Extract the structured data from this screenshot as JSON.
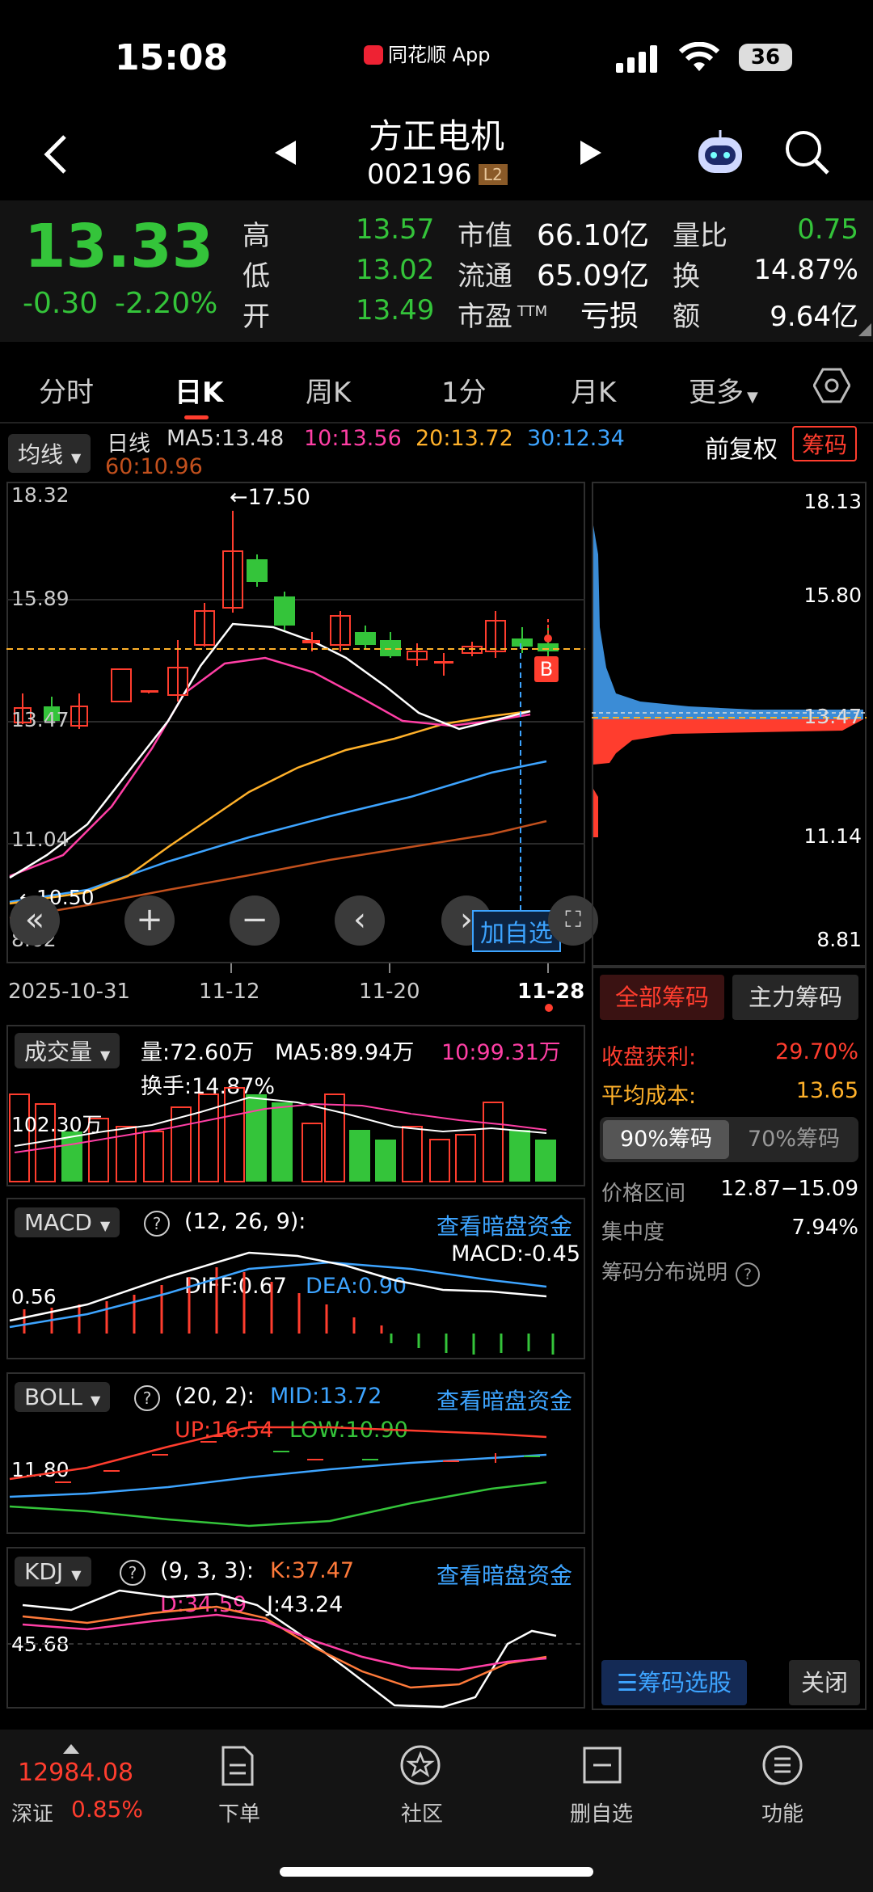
{
  "status": {
    "time": "15:08",
    "source_app": "同花顺 App",
    "battery": "36"
  },
  "header": {
    "name": "方正电机",
    "code": "002196",
    "level": "L2"
  },
  "quote": {
    "price": "13.33",
    "change": "-0.30",
    "change_pct": "-2.20%",
    "rows": [
      {
        "l1": "高",
        "v1": "13.57",
        "l2": "市值",
        "v2": "66.10亿",
        "l3": "量比",
        "v3": "0.75"
      },
      {
        "l1": "低",
        "v1": "13.02",
        "l2": "流通",
        "v2": "65.09亿",
        "l3": "换",
        "v3": "14.87%"
      },
      {
        "l1": "开",
        "v1": "13.49",
        "l2": "市盈",
        "v2": "亏损",
        "l3": "额",
        "v3": "9.64亿"
      }
    ],
    "ttm": "TTM"
  },
  "tabs": [
    "分时",
    "日K",
    "周K",
    "1分",
    "月K",
    "更多"
  ],
  "kline": {
    "indicator": "均线",
    "period": "日线",
    "ma5": "MA5:13.48",
    "ma10": "10:13.56",
    "ma20": "20:13.72",
    "ma30": "30:12.34",
    "ma60": "60:10.96",
    "adjust": "前复权",
    "chip_btn": "筹码",
    "y_labels": [
      "18.32",
      "15.89",
      "13.47",
      "11.04",
      "8.62"
    ],
    "high_mark": "←17.50",
    "low_mark": "←10.50",
    "buy_mark": "B",
    "dates": [
      "2025-10-31",
      "11-12",
      "11-20",
      "11-28"
    ],
    "add_watch": "加自选",
    "chip_y": [
      "18.13",
      "15.80",
      "13.47",
      "11.14",
      "8.81"
    ]
  },
  "chip": {
    "tab_all": "全部筹码",
    "tab_main": "主力筹码",
    "profit_label": "收盘获利:",
    "profit": "29.70%",
    "cost_label": "平均成本:",
    "cost": "13.65",
    "pct90": "90%筹码",
    "pct70": "70%筹码",
    "range_label": "价格区间",
    "range": "12.87−15.09",
    "conc_label": "集中度",
    "conc": "7.94%",
    "explain": "筹码分布说明",
    "select": "筹码选股",
    "close": "关闭"
  },
  "volume": {
    "name": "成交量",
    "vol": "量:72.60万",
    "ma5": "MA5:89.94万",
    "ma10": "10:99.31万",
    "turnover": "换手:14.87%",
    "y": "102.30万"
  },
  "macd": {
    "name": "MACD",
    "params": "(12, 26, 9):",
    "macd": "MACD:-0.45",
    "diff": "DIFF:0.67",
    "dea": "DEA:0.90",
    "y": "0.56",
    "link": "查看暗盘资金"
  },
  "boll": {
    "name": "BOLL",
    "params": "(20, 2):",
    "mid": "MID:13.72",
    "up": "UP:16.54",
    "low": "LOW:10.90",
    "y": "11.80",
    "link": "查看暗盘资金"
  },
  "kdj": {
    "name": "KDJ",
    "params": "(9, 3, 3):",
    "k": "K:37.47",
    "d": "D:34.59",
    "j": "J:43.24",
    "y": "45.68",
    "link": "查看暗盘资金"
  },
  "bottom": {
    "index_val": "12984.08",
    "index_name": "深证",
    "index_pct": "0.85%",
    "nav": [
      "下单",
      "社区",
      "删自选",
      "功能"
    ]
  },
  "colors": {
    "up": "#ff3d2e",
    "down": "#34c43a",
    "ma5": "#ffffff",
    "ma10": "#ff3fa5",
    "ma20": "#ffb12a",
    "ma30": "#3da4ff",
    "ma60": "#c2501d"
  }
}
